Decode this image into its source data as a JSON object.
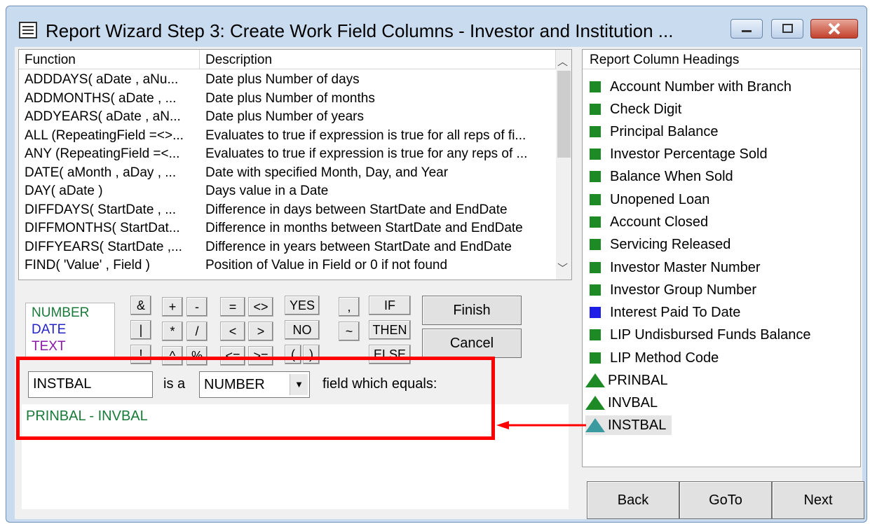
{
  "window": {
    "title": "Report Wizard Step 3:  Create Work Field Columns - Investor and Institution ..."
  },
  "functions": {
    "header": {
      "col1": "Function",
      "col2": "Description"
    },
    "rows": [
      {
        "fn": "ADDDAYS( aDate , aNu...",
        "desc": "Date plus Number of days"
      },
      {
        "fn": "ADDMONTHS( aDate , ...",
        "desc": "Date plus Number of months"
      },
      {
        "fn": "ADDYEARS( aDate , aN...",
        "desc": "Date plus Number of years"
      },
      {
        "fn": "ALL (RepeatingField =<>...",
        "desc": "Evaluates to true if expression is true for all reps of fi..."
      },
      {
        "fn": "ANY (RepeatingField =<...",
        "desc": "Evaluates to true if expression is true for any reps of ..."
      },
      {
        "fn": "DATE( aMonth , aDay , ...",
        "desc": "Date with specified Month, Day, and Year"
      },
      {
        "fn": "DAY( aDate )",
        "desc": "Days value in a Date"
      },
      {
        "fn": "DIFFDAYS( StartDate , ...",
        "desc": "Difference in days between StartDate and EndDate"
      },
      {
        "fn": "DIFFMONTHS( StartDat...",
        "desc": "Difference in months between StartDate and EndDate"
      },
      {
        "fn": "DIFFYEARS( StartDate ,...",
        "desc": "Difference in years between StartDate and EndDate"
      },
      {
        "fn": "FIND( 'Value' , Field )",
        "desc": "Position of Value in Field or 0 if not found"
      }
    ]
  },
  "legend": {
    "number": "NUMBER",
    "date": "DATE",
    "text": "TEXT",
    "number_color": "#1a7a3a",
    "date_color": "#2323c8",
    "text_color": "#8a1aa8"
  },
  "operators": {
    "amp": "&",
    "pipe": "|",
    "bang": "!",
    "plus": "+",
    "minus": "-",
    "times": "*",
    "divide": "/",
    "caret": "^",
    "percent": "%",
    "eq": "=",
    "neq": "<>",
    "lt": "<",
    "gt": ">",
    "lte": "<=",
    "gte": ">=",
    "yes": "YES",
    "no": "NO",
    "lparen": "(",
    "rparen": ")",
    "comma": ",",
    "tilde": "~",
    "if": "IF",
    "then": "THEN",
    "else": "ELSE"
  },
  "buttons": {
    "finish": "Finish",
    "cancel": "Cancel",
    "back": "Back",
    "goto": "GoTo",
    "next": "Next"
  },
  "field": {
    "name": "INSTBAL",
    "is_a": "is a",
    "type": "NUMBER",
    "equals": "field which equals:",
    "expression": "PRINBAL - INVBAL"
  },
  "columns": {
    "header": "Report Column Headings",
    "items": [
      {
        "label": "Account Number with Branch",
        "kind": "green-square"
      },
      {
        "label": "Check Digit",
        "kind": "green-square"
      },
      {
        "label": "Principal Balance",
        "kind": "green-square"
      },
      {
        "label": "Investor Percentage Sold",
        "kind": "green-square"
      },
      {
        "label": "Balance When Sold",
        "kind": "green-square"
      },
      {
        "label": "Unopened Loan",
        "kind": "green-square"
      },
      {
        "label": "Account Closed",
        "kind": "green-square"
      },
      {
        "label": "Servicing Released",
        "kind": "green-square"
      },
      {
        "label": "Investor Master Number",
        "kind": "green-square"
      },
      {
        "label": "Investor Group Number",
        "kind": "green-square"
      },
      {
        "label": "Interest Paid To Date",
        "kind": "blue-square"
      },
      {
        "label": "LIP Undisbursed Funds Balance",
        "kind": "green-square"
      },
      {
        "label": "LIP Method Code",
        "kind": "green-square"
      },
      {
        "label": "PRINBAL",
        "kind": "green-triangle"
      },
      {
        "label": "INVBAL",
        "kind": "green-triangle"
      },
      {
        "label": "INSTBAL",
        "kind": "teal-triangle"
      }
    ]
  },
  "colors": {
    "green": "#1e8a26",
    "blue": "#1e1ee6",
    "teal": "#3a9aa0",
    "highlight": "#ff0000"
  }
}
